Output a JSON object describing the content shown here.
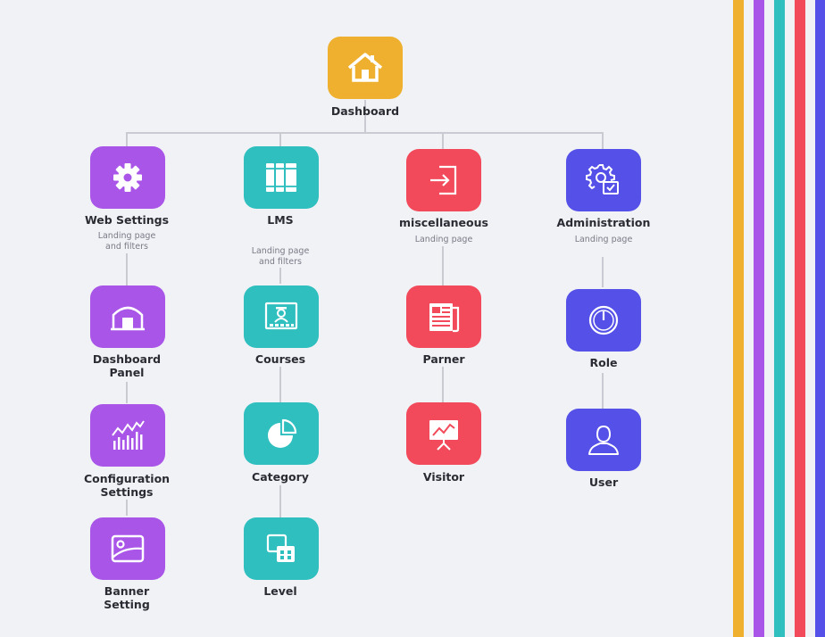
{
  "colors": {
    "orange": "#efb030",
    "purple": "#a855e8",
    "teal": "#2fbfbf",
    "red": "#f24a5a",
    "indigo": "#5450e8",
    "connector": "#c9cad2",
    "stripes": [
      "#efb030",
      "#a855e8",
      "#2fbfbf",
      "#f24a5a",
      "#5450e8"
    ]
  },
  "root": {
    "label": "Dashboard",
    "icon": "house-icon"
  },
  "columns": [
    {
      "label": "Web Settings",
      "subtitle": "Landing page\nand filters",
      "icon": "gear-icon",
      "children": [
        {
          "label": "Dashboard\nPanel",
          "icon": "garage-icon"
        },
        {
          "label": "Configuration\nSettings",
          "icon": "analytics-chart-icon"
        },
        {
          "label": "Banner\nSetting",
          "icon": "image-icon"
        }
      ]
    },
    {
      "label": "LMS",
      "subtitle": "Landing page\nand filters",
      "icon": "books-icon",
      "children": [
        {
          "label": "Courses",
          "icon": "classroom-board-icon"
        },
        {
          "label": "Category",
          "icon": "pie-chart-icon"
        },
        {
          "label": "Level",
          "icon": "windows-icon"
        }
      ]
    },
    {
      "label": "miscellaneous",
      "subtitle": "Landing page",
      "icon": "sign-in-icon",
      "children": [
        {
          "label": "Parner",
          "icon": "newspaper-icon"
        },
        {
          "label": "Visitor",
          "icon": "presentation-board-icon"
        }
      ]
    },
    {
      "label": "Administration",
      "subtitle": "Landing page",
      "icon": "user-settings-icon",
      "children": [
        {
          "label": "Role",
          "icon": "power-icon"
        },
        {
          "label": "User",
          "icon": "user-icon"
        }
      ]
    }
  ]
}
